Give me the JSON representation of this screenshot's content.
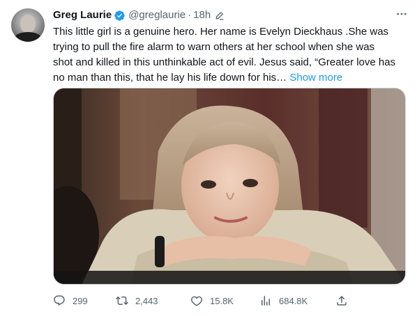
{
  "tweet": {
    "author": {
      "name": "Greg Laurie",
      "handle": "@greglaurie",
      "verified": true
    },
    "time": "18h",
    "separator": "·",
    "text_lines": [
      "This little girl is a genuine hero. Her name is Evelyn Dieckhaus .She was",
      "trying to pull the fire alarm to warn others at her school when she was",
      "shot and killed in this unthinkable act of evil. Jesus said, “Greater love has",
      "no man than this, that he lay his life down for his… "
    ],
    "show_more": "Show more",
    "actions": {
      "replies": "299",
      "retweets": "2,443",
      "likes": "15.8K",
      "views": "684.8K"
    }
  },
  "colors": {
    "accent": "#1d9bf0",
    "secondary_text": "#536471",
    "primary_text": "#0f1419"
  },
  "icons": [
    "verified-badge-icon",
    "edit-icon",
    "more-icon",
    "reply-icon",
    "retweet-icon",
    "like-icon",
    "views-icon",
    "share-icon"
  ]
}
